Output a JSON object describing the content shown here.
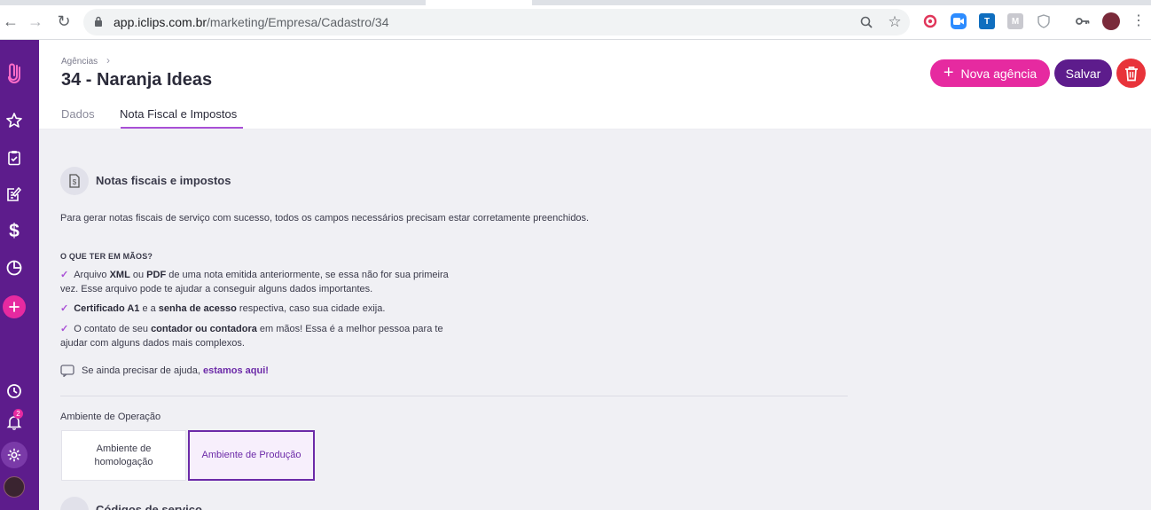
{
  "browser": {
    "url_host": "app.iclips.com.br",
    "url_path": "/marketing/Empresa/Cadastro/34"
  },
  "sidebar": {
    "notification_count": "2",
    "accent_color": "#5d1c8c"
  },
  "header": {
    "breadcrumb": "Agências",
    "title": "34 - Naranja Ideas",
    "tabs": [
      {
        "label": "Dados",
        "active": false
      },
      {
        "label": "Nota Fiscal e Impostos",
        "active": true
      }
    ],
    "new_button_label": "Nova agência",
    "save_button_label": "Salvar"
  },
  "section": {
    "title": "Notas fiscais e impostos",
    "intro": "Para gerar notas fiscais de serviço com sucesso, todos os campos necessários precisam estar corretamente preenchidos.",
    "checklist_heading": "O QUE TER EM MÃOS?",
    "checklist": [
      {
        "t1": "Arquivo ",
        "b1": "XML",
        "t2": " ou ",
        "b2": "PDF",
        "t3": " de uma nota emitida anteriormente, se essa não for sua primeira vez. Esse arquivo pode te ajudar a conseguir alguns dados importantes."
      },
      {
        "b1": "Certificado A1",
        "t2": " e a ",
        "b2": "senha de acesso",
        "t3": " respectiva, caso sua cidade exija."
      },
      {
        "t1": "O contato de seu ",
        "b1": "contador ou contadora",
        "t3": " em mãos! Essa é a melhor pessoa para te ajudar com alguns dados mais complexos."
      }
    ],
    "help_text": "Se ainda precisar de ajuda, ",
    "help_link": "estamos aqui!"
  },
  "environment": {
    "label": "Ambiente de Operação",
    "options": [
      {
        "label": "Ambiente de homologação",
        "selected": false
      },
      {
        "label": "Ambiente de Produção",
        "selected": true
      }
    ]
  },
  "section2": {
    "title": "Códigos de serviço"
  }
}
